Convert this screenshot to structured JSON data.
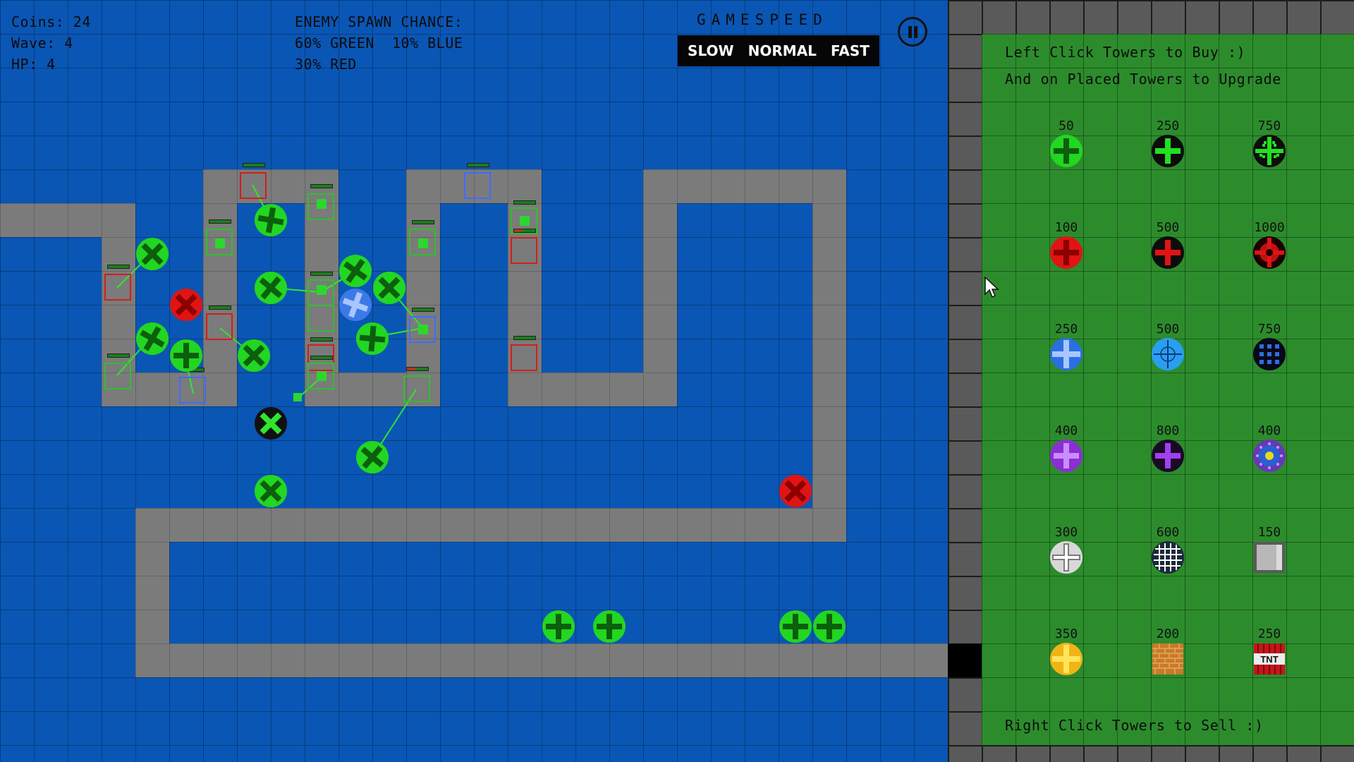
{
  "hud": {
    "coins": "Coins: 24",
    "wave": "Wave: 4",
    "hp": "HP: 4",
    "spawn_title": "ENEMY SPAWN CHANCE:",
    "spawn_line1": "60% GREEN  10% BLUE",
    "spawn_line2": "30% RED"
  },
  "gamespeed": {
    "title": "GAMESPEED",
    "slow": "SLOW",
    "normal": "NORMAL",
    "fast": "FAST"
  },
  "pause_icon": "pause-icon",
  "shop": {
    "line1": "Left Click Towers to Buy :)",
    "line2": "And on Placed Towers to Upgrade",
    "footer": "Right Click Towers to Sell :)",
    "items": [
      {
        "price": "50",
        "icon": "green-tower-1-icon"
      },
      {
        "price": "250",
        "icon": "green-tower-2-icon"
      },
      {
        "price": "750",
        "icon": "green-tower-3-icon"
      },
      {
        "price": "100",
        "icon": "red-tower-1-icon"
      },
      {
        "price": "500",
        "icon": "red-tower-2-icon"
      },
      {
        "price": "1000",
        "icon": "red-tower-3-icon"
      },
      {
        "price": "250",
        "icon": "blue-tower-1-icon"
      },
      {
        "price": "500",
        "icon": "blue-tower-2-icon"
      },
      {
        "price": "750",
        "icon": "blue-tower-3-icon"
      },
      {
        "price": "400",
        "icon": "purple-tower-1-icon"
      },
      {
        "price": "800",
        "icon": "purple-tower-2-icon"
      },
      {
        "price": "400",
        "icon": "purple-tower-3-icon"
      },
      {
        "price": "300",
        "icon": "white-tower-1-icon"
      },
      {
        "price": "600",
        "icon": "white-grid-tower-icon"
      },
      {
        "price": "150",
        "icon": "wall-block-icon"
      },
      {
        "price": "350",
        "icon": "yellow-tower-icon"
      },
      {
        "price": "200",
        "icon": "brick-wall-icon"
      },
      {
        "price": "250",
        "icon": "tnt-icon"
      }
    ],
    "tnt_label": "TNT"
  },
  "colors": {
    "water": "#0a56b4",
    "path": "#7b7b7b",
    "shop_bg": "#2c8c2c",
    "green_enemy": "#22cc22",
    "red_enemy": "#dd1111",
    "blue_enemy": "#2266dd"
  }
}
